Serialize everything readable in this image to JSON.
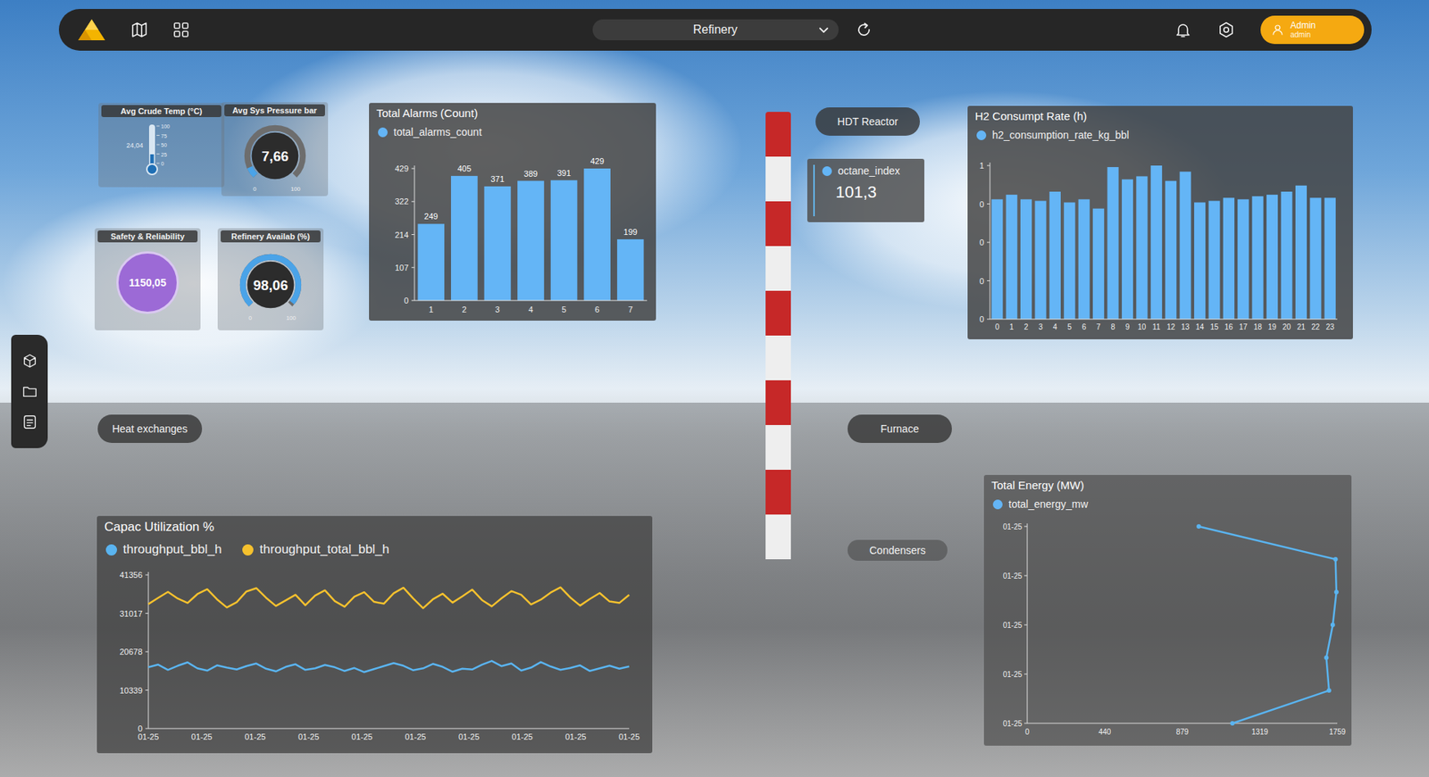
{
  "topbar": {
    "dropdown": {
      "value": "Refinery"
    },
    "user": {
      "name": "Admin",
      "role": "admin"
    }
  },
  "kpis": {
    "crude_temp": {
      "title": "Avg Crude Temp (°C)",
      "reading": "24,04",
      "ticks": [
        "100",
        "75",
        "50",
        "25",
        "0"
      ],
      "level": 0.24
    },
    "pressure": {
      "title": "Avg Sys Pressure bar",
      "value": "7,66",
      "min": "0",
      "max": "100",
      "level": 0.077
    },
    "safety": {
      "title": "Safety & Reliability",
      "value": "1150,05"
    },
    "availability": {
      "title": "Refinery Availab (%)",
      "value": "98,06",
      "min": "0",
      "max": "100",
      "level": 0.98
    }
  },
  "scene_labels": [
    "HDT Reactor",
    "Heat exchanges",
    "Furnace",
    "Condensers"
  ],
  "octane": {
    "legend": "octane_index",
    "value": "101,3"
  },
  "alarms": {
    "title": "Total Alarms (Count)",
    "legend": "total_alarms_count",
    "y_ticks": [
      "0",
      "107",
      "214",
      "322",
      "429"
    ],
    "categories": [
      "1",
      "2",
      "3",
      "4",
      "5",
      "6",
      "7"
    ],
    "values": [
      249,
      405,
      371,
      389,
      391,
      429,
      199
    ],
    "labels": [
      "249",
      "405",
      "371",
      "389",
      "391",
      "429",
      "199"
    ]
  },
  "h2": {
    "title": "H2 Consumpt Rate (h)",
    "legend": "h2_consumption_rate_kg_bbl",
    "y_ticks": [
      "0",
      "0",
      "0",
      "0",
      "1"
    ],
    "x_ticks": [
      "0",
      "1",
      "2",
      "3",
      "4",
      "5",
      "6",
      "7",
      "8",
      "9",
      "10",
      "11",
      "12",
      "13",
      "14",
      "15",
      "16",
      "17",
      "18",
      "19",
      "20",
      "21",
      "22",
      "23"
    ],
    "values": [
      0.78,
      0.81,
      0.78,
      0.77,
      0.83,
      0.76,
      0.78,
      0.72,
      0.99,
      0.91,
      0.93,
      1.0,
      0.9,
      0.96,
      0.76,
      0.77,
      0.79,
      0.78,
      0.8,
      0.81,
      0.83,
      0.87,
      0.79,
      0.79
    ]
  },
  "capacity": {
    "title": "Capac Utilization %",
    "y_ticks": [
      "0",
      "10339",
      "20678",
      "31017",
      "41356"
    ],
    "x_ticks": [
      "01-25",
      "01-25",
      "01-25",
      "01-25",
      "01-25",
      "01-25",
      "01-25",
      "01-25",
      "01-25",
      "01-25"
    ],
    "series": [
      {
        "name": "throughput_bbl_h",
        "color": "#5ab4f0",
        "values": [
          16500,
          17200,
          15800,
          16900,
          17800,
          16200,
          15600,
          17000,
          16400,
          15900,
          16800,
          17500,
          16100,
          15400,
          16600,
          17300,
          15800,
          16200,
          17100,
          16500,
          15500,
          16300,
          15200,
          16000,
          16800,
          17600,
          16900,
          15700,
          16200,
          17400,
          16600,
          15300,
          16100,
          15900,
          17200,
          18200,
          16800,
          17500,
          15600,
          16400,
          17900,
          16700,
          15800,
          16300,
          17000,
          15500,
          16200,
          16900,
          16100,
          16700
        ]
      },
      {
        "name": "throughput_total_bbl_h",
        "color": "#f5c12e",
        "values": [
          33500,
          35200,
          36800,
          35000,
          33800,
          36200,
          37500,
          34800,
          32600,
          34000,
          36900,
          37800,
          35200,
          33000,
          34500,
          36000,
          33200,
          35800,
          37200,
          34300,
          32800,
          35500,
          36700,
          34100,
          33600,
          36400,
          37900,
          35000,
          32400,
          34800,
          36300,
          33900,
          35600,
          37400,
          34600,
          32900,
          35100,
          37000,
          36000,
          33400,
          34700,
          36600,
          38000,
          35300,
          33100,
          34900,
          36500,
          34200,
          33800,
          36000
        ]
      }
    ]
  },
  "energy": {
    "title": "Total Energy (MW)",
    "legend": "total_energy_mw",
    "x_ticks": [
      "0",
      "440",
      "879",
      "1319",
      "1759"
    ],
    "y_ticks": [
      "01-25",
      "01-25",
      "01-25",
      "01-25",
      "01-25"
    ],
    "values": [
      973,
      1749,
      1754,
      1733,
      1697,
      1712,
      1164
    ]
  }
}
